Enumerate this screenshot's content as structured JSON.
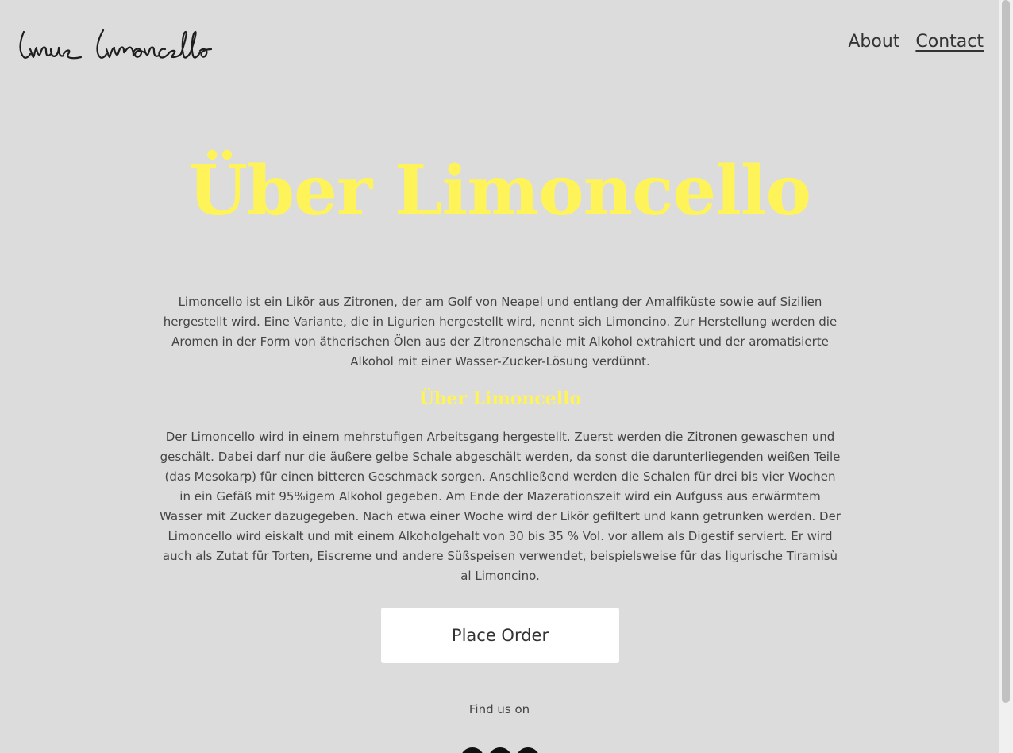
{
  "header": {
    "logo_text": "linus limoncello",
    "nav": [
      {
        "label": "About"
      },
      {
        "label": "Contact"
      }
    ]
  },
  "hero": {
    "title": "Über Limoncello"
  },
  "content": {
    "paragraph1": "Limoncello ist ein Likör aus Zitronen, der am Golf von Neapel und entlang der Amalfiküste sowie auf Sizilien hergestellt wird. Eine Variante, die in Ligurien hergestellt wird, nennt sich Limoncino. Zur Herstellung werden die Aromen in der Form von ätherischen Ölen aus der Zitronenschale mit Alkohol extrahiert und der aromatisierte Alkohol mit einer Wasser-Zucker-Lösung verdünnt.",
    "subtitle": "Über Limoncello",
    "paragraph2": "Der Limoncello wird in einem mehrstufigen Arbeitsgang hergestellt. Zuerst werden die Zitronen gewaschen und geschält. Dabei darf nur die äußere gelbe Schale abgeschält werden, da sonst die darunterliegenden weißen Teile (das Mesokarp) für einen bitteren Geschmack sorgen. Anschließend werden die Schalen für drei bis vier Wochen in ein Gefäß mit 95%igem Alkohol gegeben. Am Ende der Mazerationszeit wird ein Aufguss aus erwärmtem Wasser mit Zucker dazugegeben. Nach etwa einer Woche wird der Likör gefiltert und kann getrunken werden. Der Limoncello wird eiskalt und mit einem Alkoholgehalt von 30 bis 35 % Vol. vor allem als Digestif serviert. Er wird auch als Zutat für Torten, Eiscreme und andere Süßspeisen verwendet, beispielsweise für das ligurische Tiramisù al Limoncino."
  },
  "cta": {
    "order_label": "Place Order"
  },
  "footer": {
    "find_us": "Find us on",
    "social_icons": [
      "social-icon-1",
      "social-icon-2",
      "social-icon-3"
    ]
  },
  "colors": {
    "background": "#dcdcdc",
    "accent_yellow": "#fff35a",
    "text": "#444444",
    "button_bg": "#ffffff"
  }
}
